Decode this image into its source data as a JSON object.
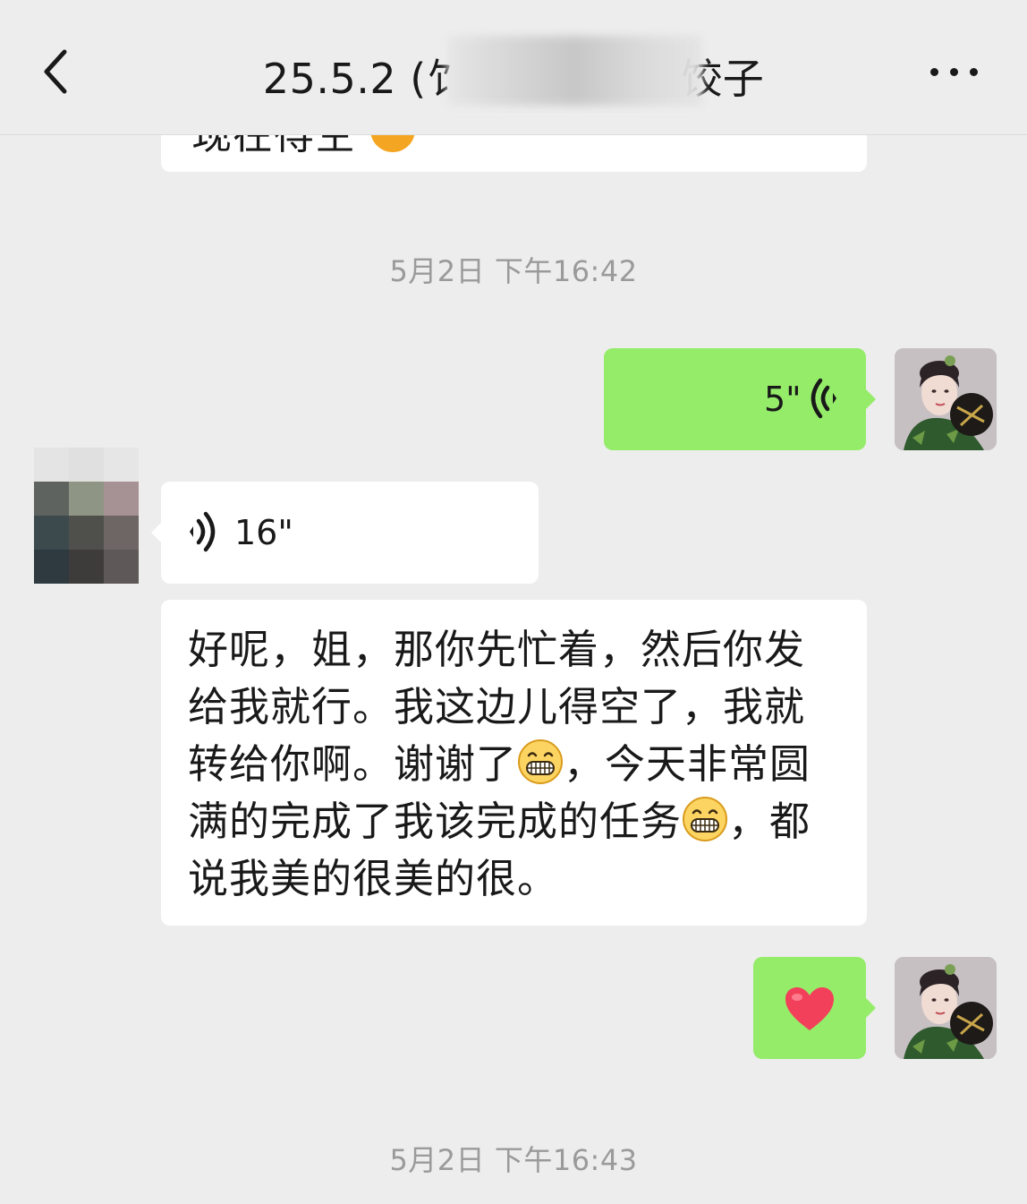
{
  "header": {
    "title": "25.5.2 (饣",
    "title_tail": "饺子",
    "back_icon": "chevron-left-icon",
    "more_icon": "more-dots-icon"
  },
  "chat": {
    "partial_prev_text": "现在得空",
    "timestamps": [
      "5月2日 下午16:42",
      "5月2日 下午16:43"
    ],
    "voice_sent": {
      "duration": "5\""
    },
    "voice_received": {
      "duration": "16\""
    },
    "received_text": {
      "part1": "好呢，姐，那你先忙着，然后你发给我就行。我这边儿得空了，我就转给你啊。谢谢了",
      "part2": "，今天非常圆满的完成了我该完成的任务",
      "part3": "，都说我美的很美的很。"
    },
    "heart_message": "heart-emoji"
  },
  "colors": {
    "background": "#ededed",
    "sent_bubble": "#95ec69",
    "received_bubble": "#ffffff",
    "timestamp": "#9a9a9a"
  }
}
